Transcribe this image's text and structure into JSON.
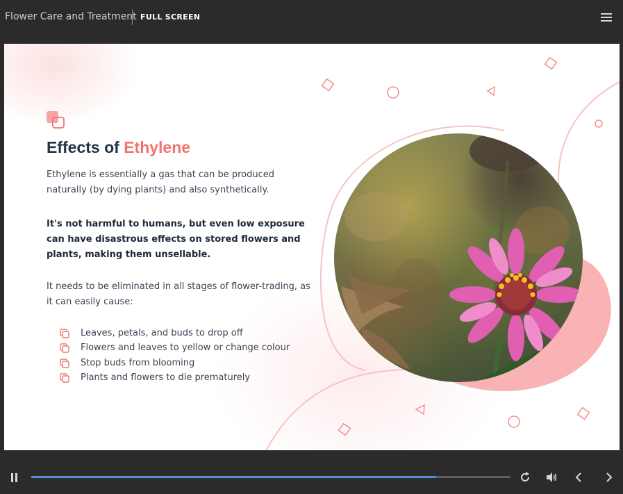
{
  "topbar": {
    "course_title": "Flower Care and Treatment",
    "fullscreen_label": "FULL SCREEN",
    "menu_icon": "hamburger-menu-icon"
  },
  "slide": {
    "heading_prefix": "Effects of ",
    "heading_accent": "Ethylene",
    "paragraph1": "Ethylene is essentially a gas that can be produced naturally (by dying plants) and also synthetically.",
    "paragraph2": "It's not harmful to humans, but even low exposure can have disastrous effects on stored flowers and plants, making them unsellable.",
    "paragraph3": "It needs to be eliminated in all stages of flower-trading, as it can easily cause:",
    "bullets": [
      "Leaves, petals, and buds to drop off",
      "Flowers and leaves to yellow or change colour",
      "Stop buds from blooming",
      "Plants and flowers to die prematurely"
    ],
    "bullet_icon": "copy-squares-icon",
    "image": "zinnia-flower-photo"
  },
  "controls": {
    "progress": 0.845,
    "icons": [
      "pause-icon",
      "replay-icon",
      "volume-icon",
      "chevron-left-icon",
      "chevron-right-icon"
    ]
  },
  "colors": {
    "accent": "#f07470",
    "heading": "#243447",
    "progress": "#5a8fd6",
    "chrome": "#2b2b2b"
  }
}
